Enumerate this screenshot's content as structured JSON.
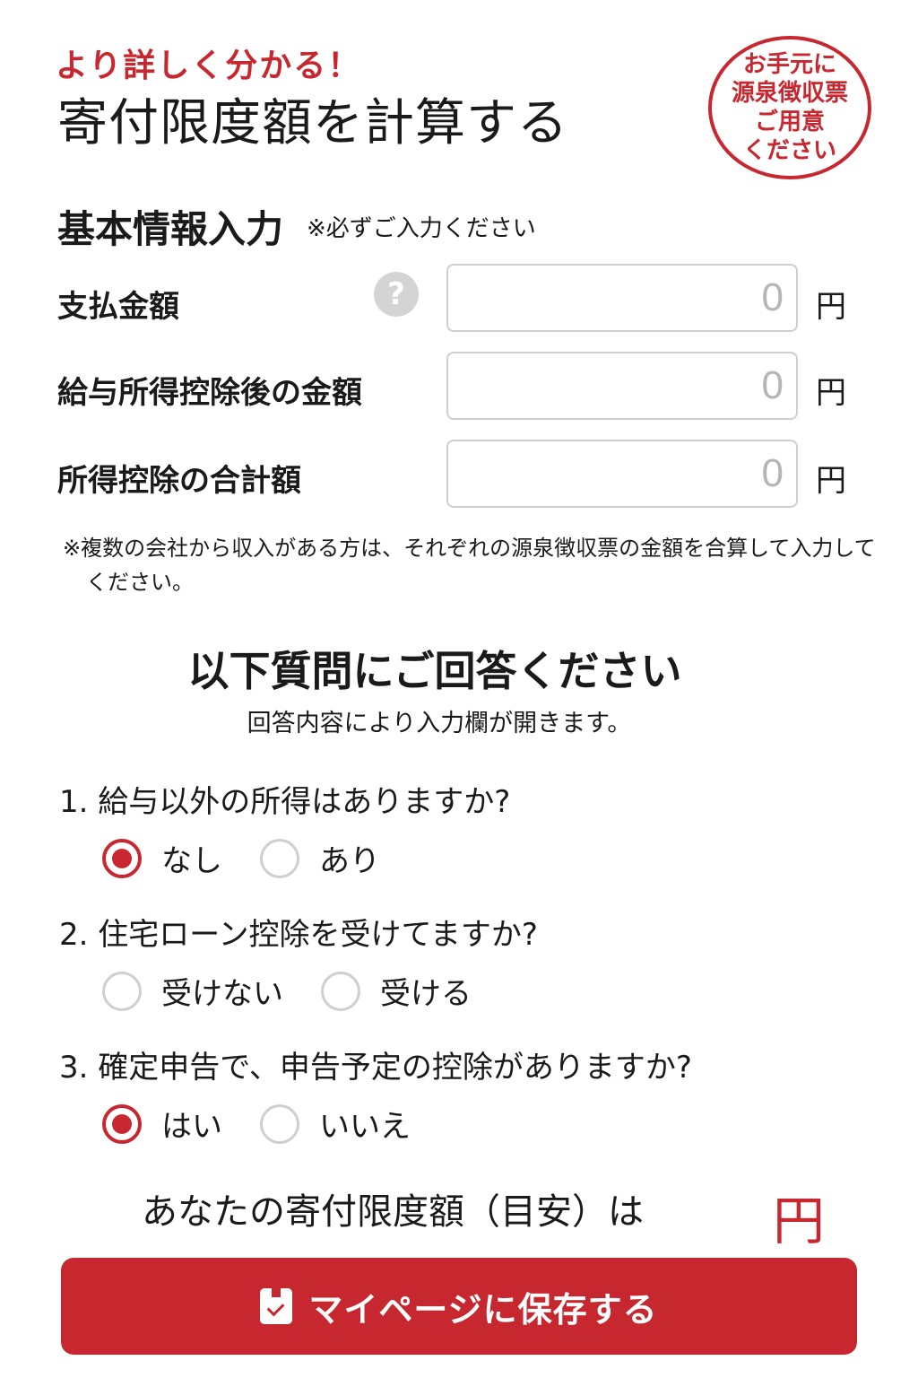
{
  "header": {
    "tagline": "より詳しく分かる！",
    "title": "寄付限度額を計算する",
    "stamp_lines": [
      "お手元に",
      "源泉徴収票",
      "ご用意",
      "ください"
    ]
  },
  "basic_info": {
    "title": "基本情報入力",
    "note": "※必ずご入力ください",
    "fields": [
      {
        "label": "支払金額",
        "value": "",
        "placeholder": "0",
        "unit": "円"
      },
      {
        "label": "給与所得控除後の金額",
        "value": "",
        "placeholder": "0",
        "unit": "円"
      },
      {
        "label": "所得控除の合計額",
        "value": "",
        "placeholder": "0",
        "unit": "円"
      }
    ],
    "help_symbol": "?",
    "footnote": "※複数の会社から収入がある方は、それぞれの源泉徴収票の金額を合算して入力してください。"
  },
  "questions_section": {
    "heading": "以下質問にご回答ください",
    "subheading": "回答内容により入力欄が開きます。",
    "questions": [
      {
        "label": "1. 給与以外の所得はありますか?",
        "options": [
          "なし",
          "あり"
        ],
        "selected": 0
      },
      {
        "label": "2. 住宅ローン控除を受けてますか?",
        "options": [
          "受けない",
          "受ける"
        ],
        "selected": null
      },
      {
        "label": "3. 確定申告で、申告予定の控除がありますか?",
        "options": [
          "はい",
          "いいえ"
        ],
        "selected": 0
      }
    ]
  },
  "result": {
    "label": "あなたの寄付限度額（目安）は",
    "unit": "円"
  },
  "save_button": {
    "label": "マイページに保存する"
  },
  "colors": {
    "accent": "#c7282f",
    "input_border": "#cfcfcf",
    "help_icon": "#d4d4d4"
  }
}
